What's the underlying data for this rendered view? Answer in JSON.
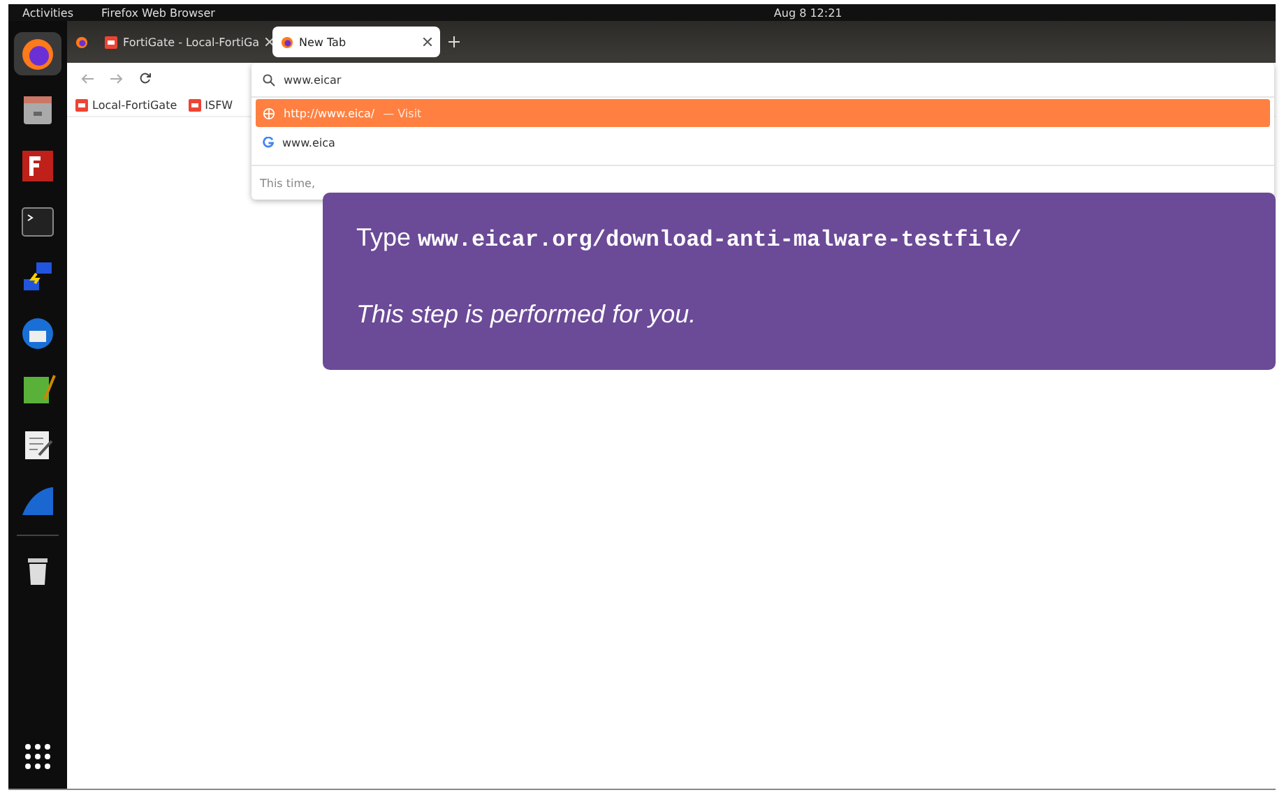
{
  "top_bar": {
    "activities": "Activities",
    "app_name": "Firefox Web Browser",
    "clock": "Aug 8  12:21"
  },
  "dock": [
    {
      "kind": "browser",
      "selected": true
    },
    {
      "kind": "files",
      "selected": false
    },
    {
      "kind": "ftp",
      "selected": false
    },
    {
      "kind": "terminal",
      "selected": false
    },
    {
      "kind": "network",
      "selected": false
    },
    {
      "kind": "mail",
      "selected": false
    },
    {
      "kind": "image-editor",
      "selected": false
    },
    {
      "kind": "text-editor",
      "selected": false
    },
    {
      "kind": "shark",
      "selected": false
    },
    {
      "kind": "trash",
      "selected": false
    },
    {
      "kind": "apps",
      "selected": false
    }
  ],
  "tabs": [
    {
      "label": "FortiGate - Local-FortiGa",
      "selected": false
    },
    {
      "label": "New Tab",
      "selected": true
    }
  ],
  "address_bar": {
    "value": "www.eicar"
  },
  "bookmarks": [
    "Local-FortiGate",
    "ISFW"
  ],
  "suggestions": [
    {
      "kind": "visit",
      "text": "http://www.eica/",
      "action": "— Visit",
      "selected": true
    },
    {
      "kind": "search",
      "text": "www.eica",
      "selected": false
    }
  ],
  "suggestion_footer": "This time,",
  "callout": {
    "lead": "Type",
    "code": "www.eicar.org/download-anti-malware-testfile/",
    "note": "This step is performed for you."
  }
}
